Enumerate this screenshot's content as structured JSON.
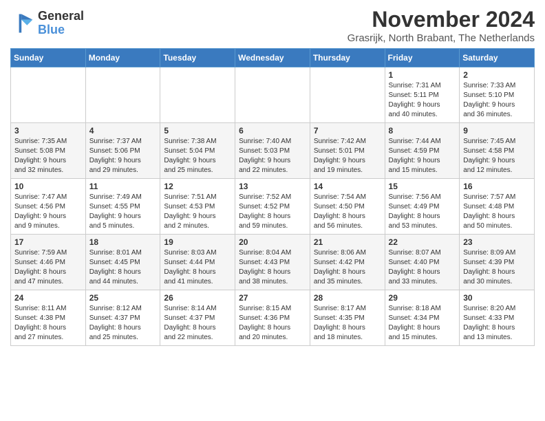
{
  "header": {
    "logo_line1": "General",
    "logo_line2": "Blue",
    "month": "November 2024",
    "location": "Grasrijk, North Brabant, The Netherlands"
  },
  "weekdays": [
    "Sunday",
    "Monday",
    "Tuesday",
    "Wednesday",
    "Thursday",
    "Friday",
    "Saturday"
  ],
  "weeks": [
    [
      {
        "day": "",
        "text": ""
      },
      {
        "day": "",
        "text": ""
      },
      {
        "day": "",
        "text": ""
      },
      {
        "day": "",
        "text": ""
      },
      {
        "day": "",
        "text": ""
      },
      {
        "day": "1",
        "text": "Sunrise: 7:31 AM\nSunset: 5:11 PM\nDaylight: 9 hours\nand 40 minutes."
      },
      {
        "day": "2",
        "text": "Sunrise: 7:33 AM\nSunset: 5:10 PM\nDaylight: 9 hours\nand 36 minutes."
      }
    ],
    [
      {
        "day": "3",
        "text": "Sunrise: 7:35 AM\nSunset: 5:08 PM\nDaylight: 9 hours\nand 32 minutes."
      },
      {
        "day": "4",
        "text": "Sunrise: 7:37 AM\nSunset: 5:06 PM\nDaylight: 9 hours\nand 29 minutes."
      },
      {
        "day": "5",
        "text": "Sunrise: 7:38 AM\nSunset: 5:04 PM\nDaylight: 9 hours\nand 25 minutes."
      },
      {
        "day": "6",
        "text": "Sunrise: 7:40 AM\nSunset: 5:03 PM\nDaylight: 9 hours\nand 22 minutes."
      },
      {
        "day": "7",
        "text": "Sunrise: 7:42 AM\nSunset: 5:01 PM\nDaylight: 9 hours\nand 19 minutes."
      },
      {
        "day": "8",
        "text": "Sunrise: 7:44 AM\nSunset: 4:59 PM\nDaylight: 9 hours\nand 15 minutes."
      },
      {
        "day": "9",
        "text": "Sunrise: 7:45 AM\nSunset: 4:58 PM\nDaylight: 9 hours\nand 12 minutes."
      }
    ],
    [
      {
        "day": "10",
        "text": "Sunrise: 7:47 AM\nSunset: 4:56 PM\nDaylight: 9 hours\nand 9 minutes."
      },
      {
        "day": "11",
        "text": "Sunrise: 7:49 AM\nSunset: 4:55 PM\nDaylight: 9 hours\nand 5 minutes."
      },
      {
        "day": "12",
        "text": "Sunrise: 7:51 AM\nSunset: 4:53 PM\nDaylight: 9 hours\nand 2 minutes."
      },
      {
        "day": "13",
        "text": "Sunrise: 7:52 AM\nSunset: 4:52 PM\nDaylight: 8 hours\nand 59 minutes."
      },
      {
        "day": "14",
        "text": "Sunrise: 7:54 AM\nSunset: 4:50 PM\nDaylight: 8 hours\nand 56 minutes."
      },
      {
        "day": "15",
        "text": "Sunrise: 7:56 AM\nSunset: 4:49 PM\nDaylight: 8 hours\nand 53 minutes."
      },
      {
        "day": "16",
        "text": "Sunrise: 7:57 AM\nSunset: 4:48 PM\nDaylight: 8 hours\nand 50 minutes."
      }
    ],
    [
      {
        "day": "17",
        "text": "Sunrise: 7:59 AM\nSunset: 4:46 PM\nDaylight: 8 hours\nand 47 minutes."
      },
      {
        "day": "18",
        "text": "Sunrise: 8:01 AM\nSunset: 4:45 PM\nDaylight: 8 hours\nand 44 minutes."
      },
      {
        "day": "19",
        "text": "Sunrise: 8:03 AM\nSunset: 4:44 PM\nDaylight: 8 hours\nand 41 minutes."
      },
      {
        "day": "20",
        "text": "Sunrise: 8:04 AM\nSunset: 4:43 PM\nDaylight: 8 hours\nand 38 minutes."
      },
      {
        "day": "21",
        "text": "Sunrise: 8:06 AM\nSunset: 4:42 PM\nDaylight: 8 hours\nand 35 minutes."
      },
      {
        "day": "22",
        "text": "Sunrise: 8:07 AM\nSunset: 4:40 PM\nDaylight: 8 hours\nand 33 minutes."
      },
      {
        "day": "23",
        "text": "Sunrise: 8:09 AM\nSunset: 4:39 PM\nDaylight: 8 hours\nand 30 minutes."
      }
    ],
    [
      {
        "day": "24",
        "text": "Sunrise: 8:11 AM\nSunset: 4:38 PM\nDaylight: 8 hours\nand 27 minutes."
      },
      {
        "day": "25",
        "text": "Sunrise: 8:12 AM\nSunset: 4:37 PM\nDaylight: 8 hours\nand 25 minutes."
      },
      {
        "day": "26",
        "text": "Sunrise: 8:14 AM\nSunset: 4:37 PM\nDaylight: 8 hours\nand 22 minutes."
      },
      {
        "day": "27",
        "text": "Sunrise: 8:15 AM\nSunset: 4:36 PM\nDaylight: 8 hours\nand 20 minutes."
      },
      {
        "day": "28",
        "text": "Sunrise: 8:17 AM\nSunset: 4:35 PM\nDaylight: 8 hours\nand 18 minutes."
      },
      {
        "day": "29",
        "text": "Sunrise: 8:18 AM\nSunset: 4:34 PM\nDaylight: 8 hours\nand 15 minutes."
      },
      {
        "day": "30",
        "text": "Sunrise: 8:20 AM\nSunset: 4:33 PM\nDaylight: 8 hours\nand 13 minutes."
      }
    ]
  ]
}
